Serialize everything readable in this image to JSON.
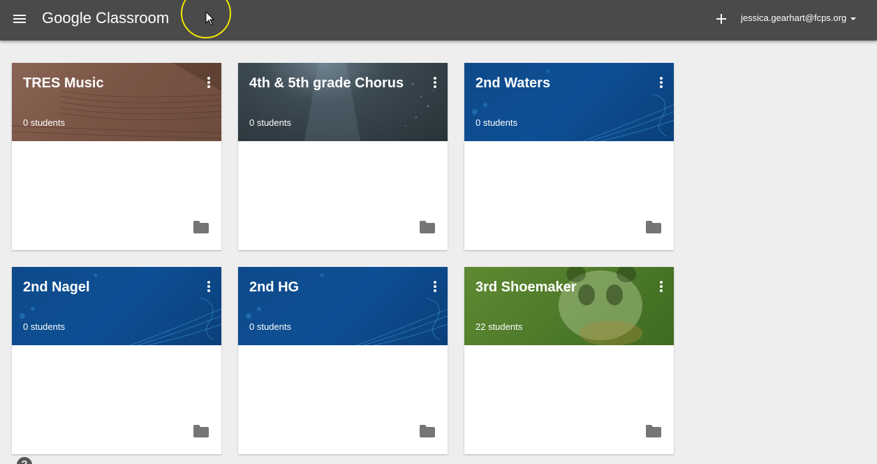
{
  "header": {
    "brand": "Google Classroom",
    "account": "jessica.gearhart@fcps.org"
  },
  "icons": {
    "menu": "hamburger-menu-icon",
    "add": "plus-icon",
    "more": "more-vert-icon",
    "folder": "folder-icon",
    "help": "help-icon"
  },
  "colors": {
    "topbar": "#4a4a4a",
    "background": "#eeeeee",
    "card_brown": "#7a5546",
    "card_dark": "#3c4a52",
    "card_blue": "#0d4f94",
    "card_green": "#4e7a2a"
  },
  "classes": [
    {
      "name": "TRES Music",
      "students": "0 students"
    },
    {
      "name": "4th & 5th grade Chorus",
      "students": "0 students"
    },
    {
      "name": "2nd Waters",
      "students": "0 students"
    },
    {
      "name": "2nd Nagel",
      "students": "0 students"
    },
    {
      "name": "2nd HG",
      "students": "0 students"
    },
    {
      "name": "3rd Shoemaker",
      "students": "22 students"
    }
  ],
  "help": {
    "label": "?"
  }
}
